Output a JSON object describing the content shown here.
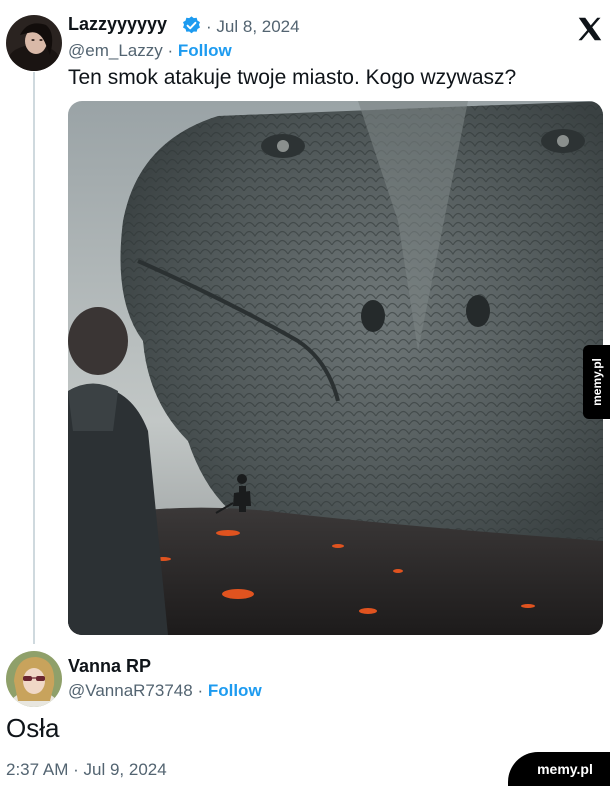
{
  "tweet": {
    "author_name": "Lazzyyyyyy",
    "verified": true,
    "date": "Jul 8, 2024",
    "handle": "@em_Lazzy",
    "follow_label": "Follow",
    "text": "Ten smok atakuje twoje miasto. Kogo wzywasz?",
    "platform_icon": "x-logo-icon"
  },
  "reply": {
    "author_name": "Vanna RP",
    "handle": "@VannaR73748",
    "follow_label": "Follow",
    "text": "Osła",
    "time": "2:37 AM",
    "date": "Jul 9, 2024"
  },
  "watermarks": {
    "side": "memy.pl",
    "bottom": "memy.pl"
  },
  "colors": {
    "accent": "#1d9bf0",
    "secondary_text": "#536471",
    "thread_line": "#cfd9de"
  },
  "separator": "·"
}
